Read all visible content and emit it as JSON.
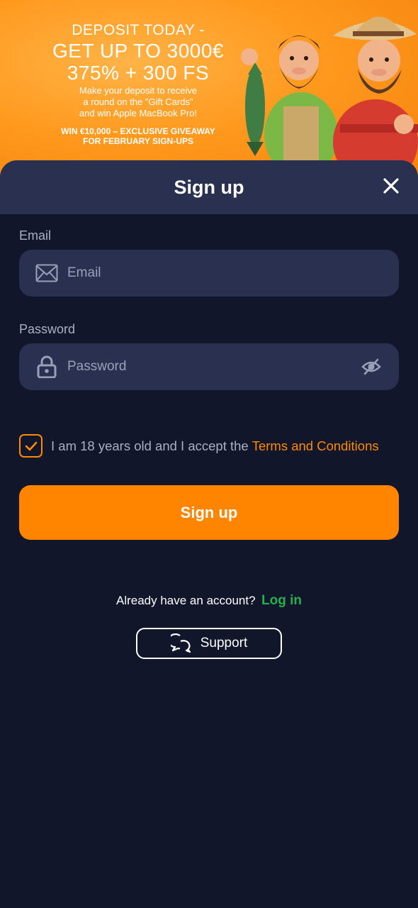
{
  "banner": {
    "line1": "DEPOSIT TODAY -",
    "line2": "GET UP TO 3000€",
    "line3": "375% + 300 FS",
    "desc1": "Make your deposit to receive",
    "desc2": "a round on the \"Gift Cards\"",
    "desc3": "and win Apple MacBook Pro!",
    "give1": "WIN €10,000 – EXCLUSIVE GIVEAWAY",
    "give2": "FOR FEBRUARY SIGN-UPS"
  },
  "modal": {
    "title": "Sign up",
    "email": {
      "label": "Email",
      "placeholder": "Email",
      "value": ""
    },
    "password": {
      "label": "Password",
      "placeholder": "Password",
      "value": ""
    },
    "terms": {
      "checked": true,
      "text": "I am 18 years old and I accept the",
      "link": "Terms and Conditions"
    },
    "submit_label": "Sign up",
    "account_text": "Already have an account?",
    "login_label": "Log in",
    "support_label": "Support"
  },
  "colors": {
    "accent": "#ff8500",
    "login_green": "#22b14c",
    "background": "#11162b",
    "surface": "#2a3150"
  },
  "icons": [
    "close-icon",
    "mail-icon",
    "lock-icon",
    "eye-off-icon",
    "checkmark-icon",
    "chat-bubbles-icon"
  ]
}
